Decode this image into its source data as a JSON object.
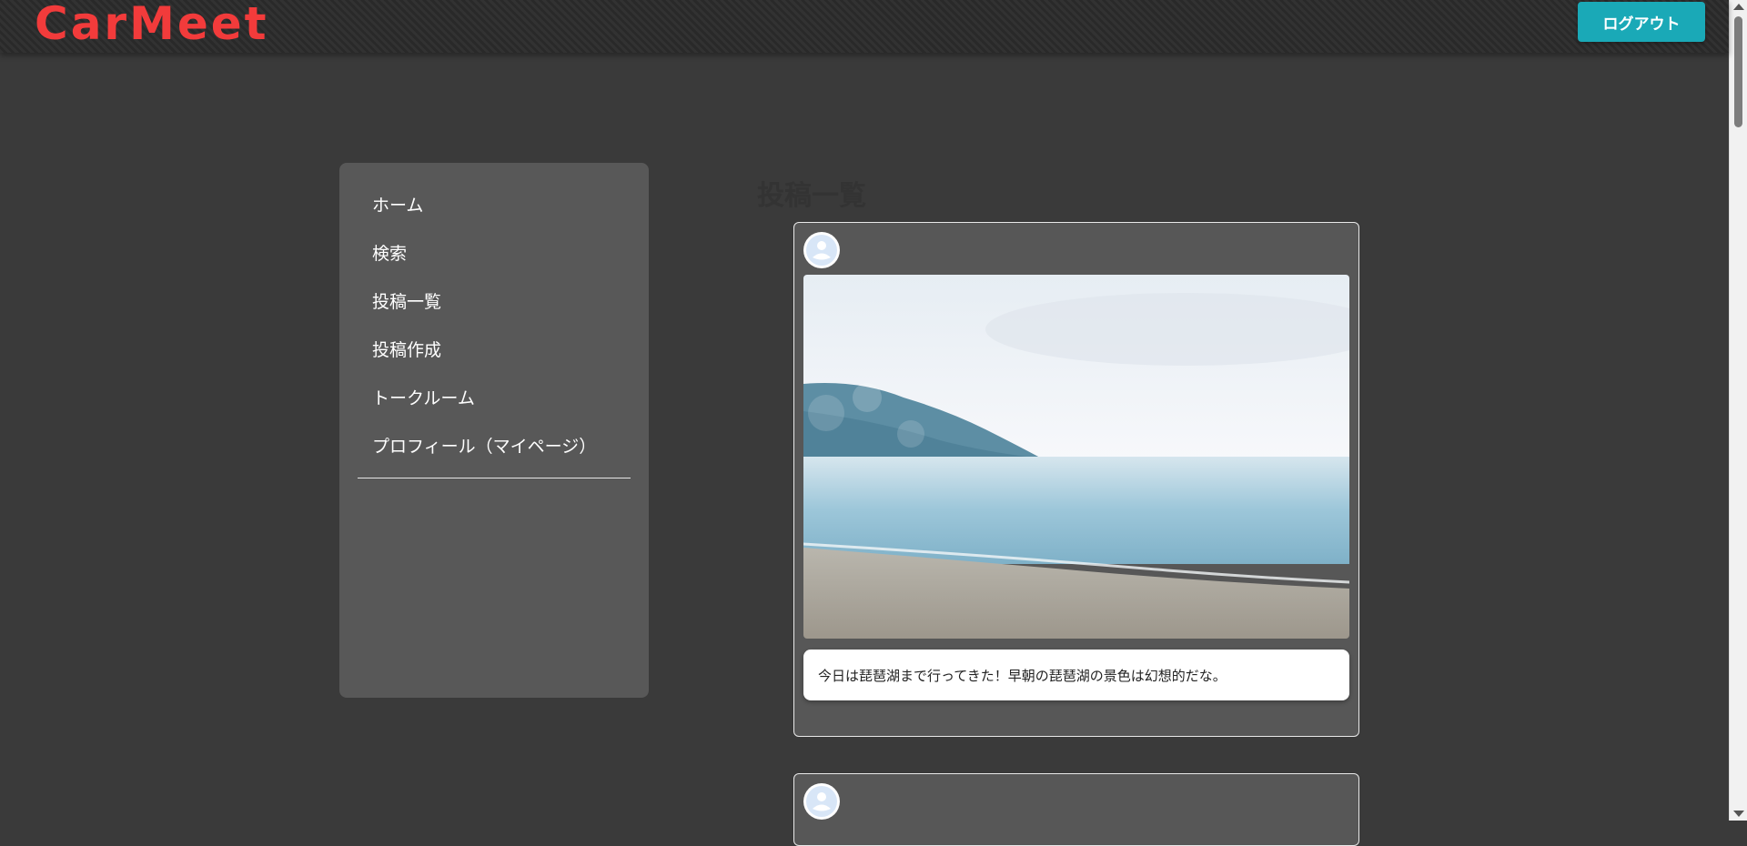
{
  "header": {
    "logo": "CarMeet",
    "logout_label": "ログアウト"
  },
  "sidebar": {
    "items": [
      {
        "label": "ホーム"
      },
      {
        "label": "検索"
      },
      {
        "label": "投稿一覧"
      },
      {
        "label": "投稿作成"
      },
      {
        "label": "トークルーム"
      },
      {
        "label": "プロフィール（マイページ）"
      }
    ]
  },
  "main": {
    "heading": "投稿一覧",
    "posts": [
      {
        "avatar_icon": "user-avatar-icon",
        "image": "lake-shore-photo",
        "caption": "今日は琵琶湖まで行ってきた！早朝の琵琶湖の景色は幻想的だな。"
      },
      {
        "avatar_icon": "user-avatar-icon"
      }
    ]
  },
  "colors": {
    "accent": "#1aa9b7",
    "logo": "#f23b3b",
    "background": "#3a3a3a",
    "panel": "#585858"
  }
}
